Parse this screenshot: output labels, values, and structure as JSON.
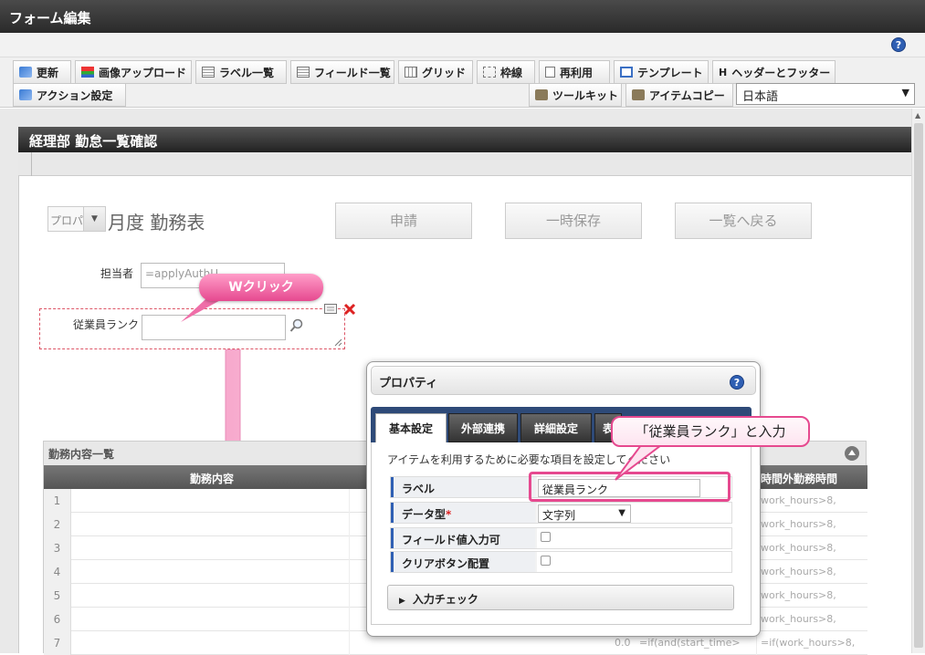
{
  "window": {
    "title": "フォーム編集"
  },
  "toolbar": {
    "row1": [
      "更新",
      "画像アップロード",
      "ラベル一覧",
      "フィールド一覧",
      "グリッド",
      "枠線",
      "再利用",
      "テンプレート",
      "ヘッダーとフッター"
    ],
    "row2_left": "アクション設定",
    "row2_right": [
      "ツールキット",
      "アイテムコピー"
    ],
    "language": "日本語"
  },
  "form": {
    "title": "経理部 勤怠一覧確認",
    "year_select": "プロパ",
    "heading": "月度 勤務表",
    "buttons": {
      "apply": "申請",
      "save": "一時保存",
      "back": "一覧へ戻る"
    },
    "owner_label": "担当者",
    "owner_value": "=applyAuthU",
    "rank_label": "従業員ランク"
  },
  "callouts": {
    "dblclick": "Wクリック",
    "input": "「従業員ランク」と入力"
  },
  "grid": {
    "title": "勤務内容一覧",
    "col_content": "勤務内容",
    "col_overtime": "時間外勤務時間",
    "rows": [
      "1",
      "2",
      "3",
      "4",
      "5",
      "6",
      "7"
    ],
    "formula_short": "work_hours>8,",
    "row7_value": "0.0",
    "row7_formula": "=if(and(start_time>",
    "row7_formula2": "=if(work_hours>8,"
  },
  "dialog": {
    "title": "プロパティ",
    "tabs": [
      "基本設定",
      "外部連携",
      "詳細設定",
      "表"
    ],
    "description": "アイテムを利用するために必要な項目を設定してください",
    "rows": {
      "label": {
        "name": "ラベル",
        "value": "従業員ランク"
      },
      "datatype": {
        "name": "データ型",
        "required": "*",
        "value": "文字列"
      },
      "field_input": {
        "name": "フィールド値入力可"
      },
      "clear_btn": {
        "name": "クリアボタン配置"
      }
    },
    "expander": "入力チェック"
  }
}
